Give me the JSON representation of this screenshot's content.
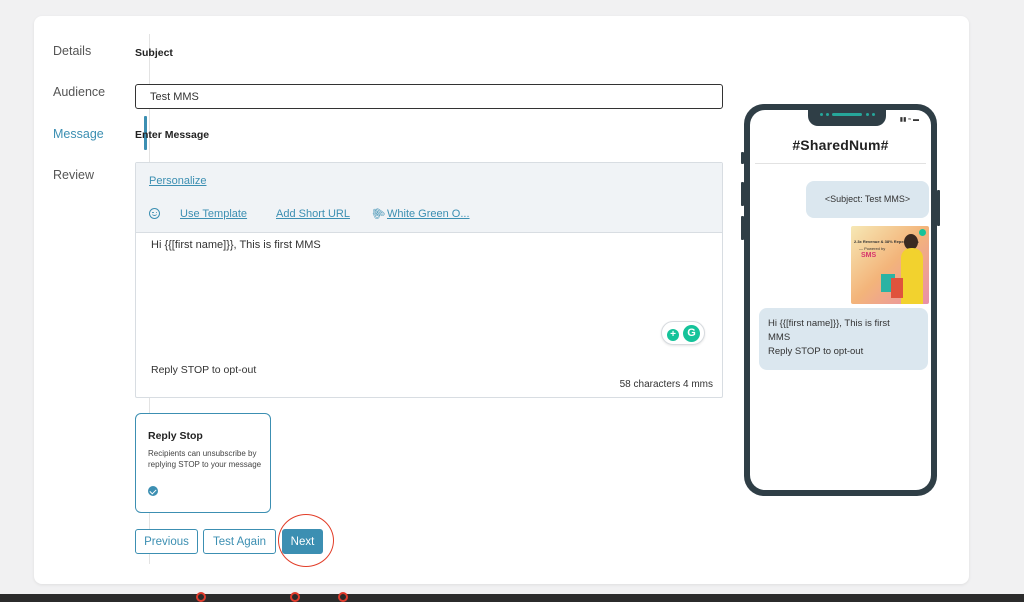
{
  "steps": [
    {
      "label": "Details"
    },
    {
      "label": "Audience"
    },
    {
      "label": "Message",
      "active": true
    },
    {
      "label": "Review"
    }
  ],
  "form": {
    "subject_label": "Subject",
    "subject_value": "Test MMS",
    "message_label": "Enter Message",
    "personalize": "Personalize",
    "use_template": "Use Template",
    "add_short_url": "Add Short URL",
    "attachment": "White Green O...",
    "message_text": "Hi {{[first name]}}, This is first MMS",
    "reply_line": "Reply STOP to opt-out",
    "char_count": "58 characters 4 mms"
  },
  "reply_stop": {
    "title": "Reply Stop",
    "description": "Recipients can unsubscribe by replying STOP to your message",
    "checked": true
  },
  "buttons": {
    "previous": "Previous",
    "test_again": "Test Again",
    "next": "Next"
  },
  "phone": {
    "title": "#SharedNum#",
    "subject_bubble": "<Subject: Test MMS>",
    "image": {
      "line1": "2.3x Revenue & 38% Repeat Sales",
      "line2": "— Powered by",
      "line3": "SMS"
    },
    "message_line1": "Hi {{[first name]}}, This is first",
    "message_line2": "MMS",
    "message_line3": "Reply STOP to opt-out"
  },
  "colors": {
    "accent": "#3c8fb2",
    "phone_frame": "#2f3e46",
    "bubble": "#dbe7ef",
    "highlight": "#e23d28"
  }
}
